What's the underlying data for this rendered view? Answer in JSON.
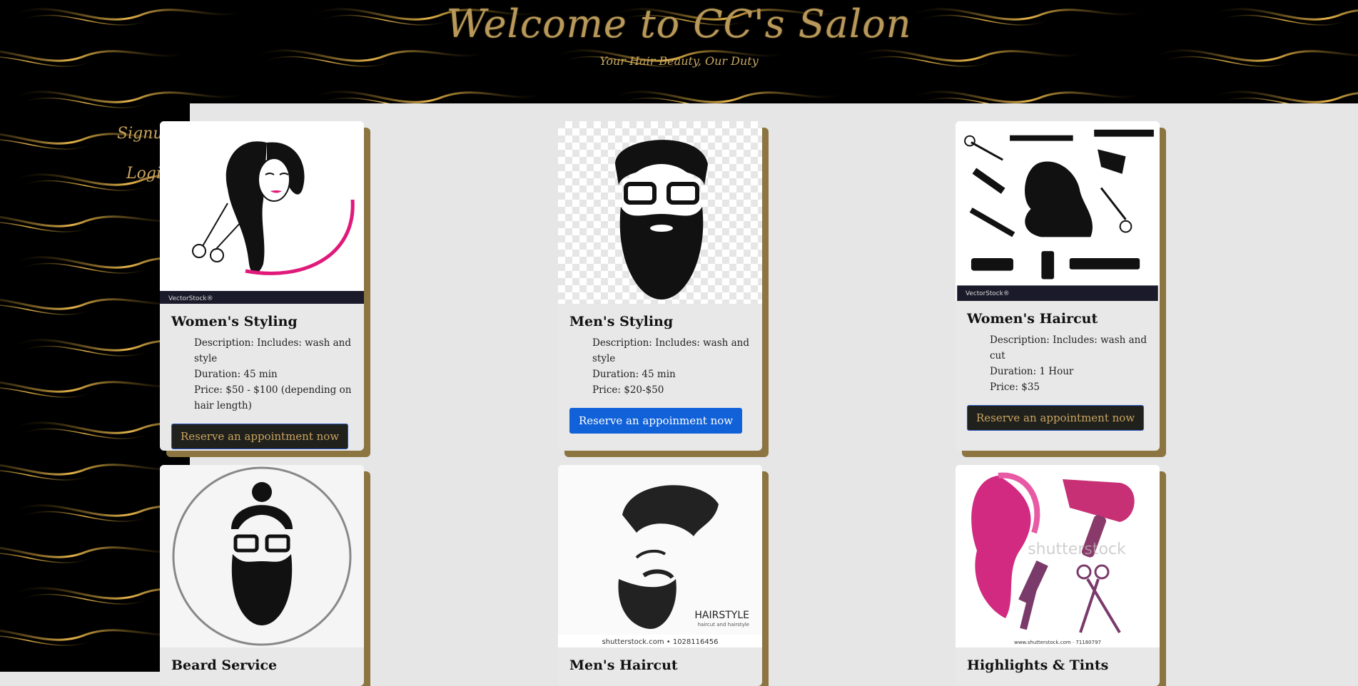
{
  "header": {
    "title": "Welcome to CC's Salon",
    "tagline": "Your Hair Beauty, Our Duty"
  },
  "sidebar": {
    "items": [
      {
        "label": "Signup"
      },
      {
        "label": "Login"
      }
    ]
  },
  "colors": {
    "gold": "#c6a25e",
    "card_shadow": "#8c7540",
    "button_blue": "#1161d9",
    "button_dark": "#20201c"
  },
  "services": [
    {
      "title": "Women's Styling",
      "details": [
        "Description: Includes: wash and style",
        "Duration: 45 min",
        "Price: $50 - $100 (depending on hair length)"
      ],
      "button": "Reserve an appointment now",
      "button_style": "dark",
      "image_icon": "woman-face-scissors-icon",
      "image_caption": "VectorStock"
    },
    {
      "title": "Men's Styling",
      "details": [
        "Description: Includes: wash and style",
        "Duration: 45 min",
        "Price: $20-$50"
      ],
      "button": "Reserve an appoinment now",
      "button_style": "blue",
      "image_icon": "bearded-man-glasses-icon",
      "image_caption": ""
    },
    {
      "title": "Women's Haircut",
      "details": [
        "Description: Includes: wash and cut",
        "Duration: 1 Hour",
        "Price: $35"
      ],
      "button": "Reserve an appointment now",
      "button_style": "dark",
      "image_icon": "salon-tools-icon",
      "image_caption": "VectorStock"
    },
    {
      "title": "Beard Service",
      "details": [],
      "button": "",
      "image_icon": "man-bun-beard-icon",
      "image_caption": ""
    },
    {
      "title": "Men's Haircut",
      "details": [],
      "button": "",
      "image_icon": "man-hairstyle-icon",
      "image_caption": "HAIRSTYLE",
      "image_subcaption": "haircut and hairstyle",
      "image_footer": "shutterstock.com • 1028116456"
    },
    {
      "title": "Highlights & Tints",
      "details": [],
      "button": "",
      "image_icon": "pink-hair-dryer-icon",
      "image_caption": "shutterstock",
      "image_footer": "www.shutterstock.com · 71180797"
    }
  ]
}
